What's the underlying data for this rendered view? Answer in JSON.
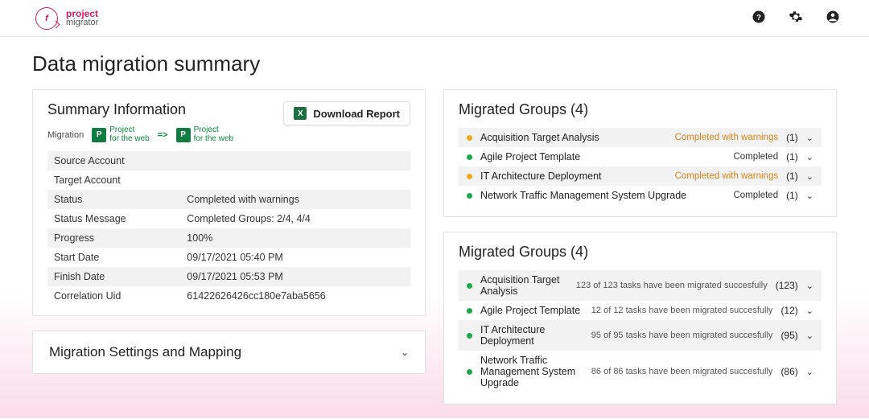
{
  "brand": {
    "line1": "project",
    "line2": "migrator",
    "logoLetter": "f"
  },
  "pageTitle": "Data migration summary",
  "summary": {
    "title": "Summary Information",
    "downloadLabel": "Download Report",
    "migrationLabel": "Migration",
    "sourceProduct": {
      "line1": "Project",
      "line2": "for the web"
    },
    "targetProduct": {
      "line1": "Project",
      "line2": "for the web"
    },
    "rows": [
      {
        "label": "Source Account",
        "value": ""
      },
      {
        "label": "Target Account",
        "value": ""
      },
      {
        "label": "Status",
        "value": "Completed with warnings"
      },
      {
        "label": "Status Message",
        "value": "Completed Groups: 2/4, 4/4"
      },
      {
        "label": "Progress",
        "value": "100%"
      },
      {
        "label": "Start Date",
        "value": "09/17/2021 05:40 PM"
      },
      {
        "label": "Finish Date",
        "value": "09/17/2021 05:53 PM"
      },
      {
        "label": "Correlation Uid",
        "value": "61422626426cc180e7aba5656"
      }
    ]
  },
  "settings": {
    "title": "Migration Settings and Mapping"
  },
  "groupsA": {
    "title": "Migrated Groups (4)",
    "items": [
      {
        "dot": "orange",
        "name": "Acquisition Target Analysis",
        "status": "Completed with warnings",
        "statusKind": "warn",
        "count": "(1)"
      },
      {
        "dot": "green",
        "name": "Agile Project Template",
        "status": "Completed",
        "statusKind": "ok",
        "count": "(1)"
      },
      {
        "dot": "orange",
        "name": "IT Architecture Deployment",
        "status": "Completed with warnings",
        "statusKind": "warn",
        "count": "(1)"
      },
      {
        "dot": "green",
        "name": "Network Traffic Management System Upgrade",
        "status": "Completed",
        "statusKind": "ok",
        "count": "(1)"
      }
    ]
  },
  "groupsB": {
    "title": "Migrated Groups (4)",
    "items": [
      {
        "dot": "green",
        "name": "Acquisition Target Analysis",
        "sub": "123 of 123 tasks have been migrated succesfully",
        "count": "(123)"
      },
      {
        "dot": "green",
        "name": "Agile Project Template",
        "sub": "12 of 12 tasks have been migrated succesfully",
        "count": "(12)"
      },
      {
        "dot": "green",
        "name": "IT Architecture Deployment",
        "sub": "95 of 95 tasks have been migrated succesfully",
        "count": "(95)"
      },
      {
        "dot": "green",
        "name": "Network Traffic Management System Upgrade",
        "sub": "86 of 86 tasks have been migrated succesfully",
        "count": "(86)"
      }
    ]
  }
}
